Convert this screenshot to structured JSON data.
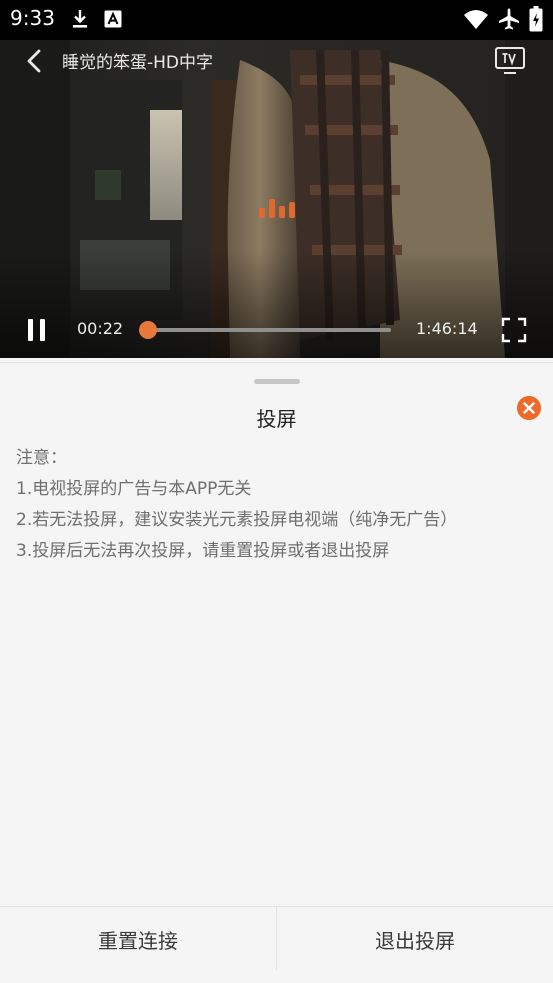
{
  "status_bar": {
    "time": "9:33",
    "icons": [
      "download-icon",
      "a-notification-icon",
      "wifi-icon",
      "airplane-icon",
      "battery-charging-icon"
    ]
  },
  "player": {
    "title": "睡觉的笨蛋-HD中字",
    "state": "playing",
    "current_time": "00:22",
    "total_time": "1:46:14",
    "progress_fraction": 0.004,
    "accent_color": "#e8773c",
    "icons": [
      "back-arrow-icon",
      "tv-cast-icon",
      "buffering-icon",
      "pause-icon",
      "fullscreen-icon"
    ]
  },
  "cast_sheet": {
    "title": "投屏",
    "close_icon": "close-icon",
    "notice_lines": [
      "注意：",
      "1.电视投屏的广告与本APP无关",
      "2.若无法投屏，建议安装光元素投屏电视端（纯净无广告）",
      "3.投屏后无法再次投屏，请重置投屏或者退出投屏"
    ],
    "actions": {
      "reset_label": "重置连接",
      "exit_label": "退出投屏"
    }
  }
}
